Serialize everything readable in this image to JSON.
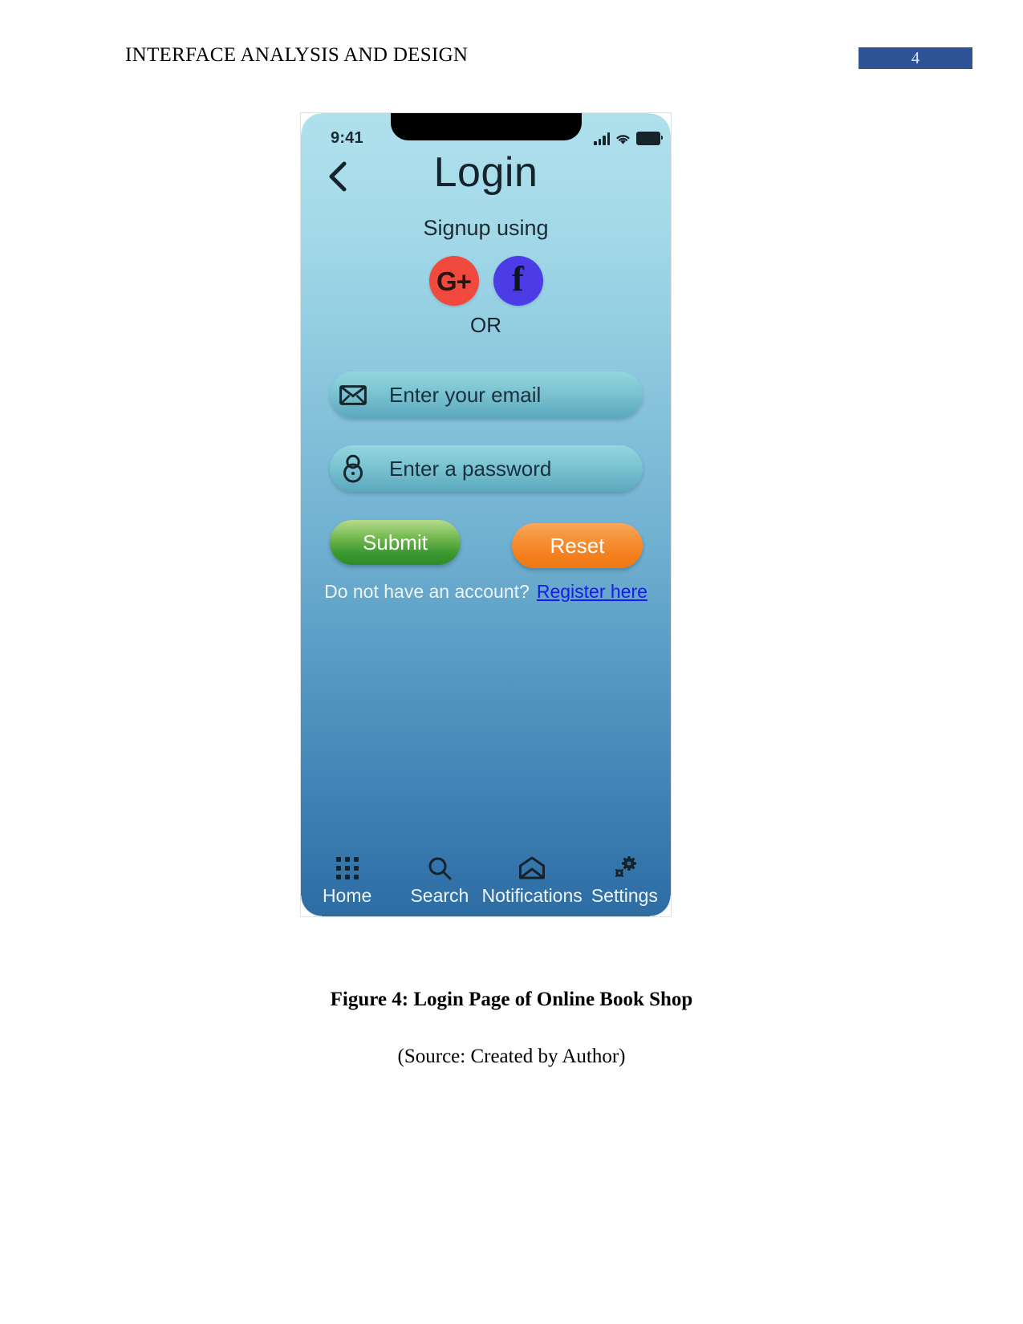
{
  "document": {
    "header_title": "INTERFACE ANALYSIS AND DESIGN",
    "page_number": "4",
    "figure_caption": "Figure 4: Login Page of Online Book Shop",
    "source_caption": "(Source:  Created by Author)",
    "page_number_color": "#2F5496"
  },
  "phone": {
    "status_bar": {
      "time": "9:41",
      "signal_icon": "signal-bars-icon",
      "wifi_icon": "wifi-icon",
      "battery_icon": "battery-icon"
    },
    "app_header": {
      "back_icon": "back-chevron-icon",
      "title": "Login"
    },
    "signup": {
      "label": "Signup using",
      "providers": [
        {
          "name": "google-plus",
          "glyph": "G+",
          "color": "#F2493E"
        },
        {
          "name": "facebook",
          "glyph": "f",
          "color": "#4B3CE8"
        }
      ],
      "divider": "OR"
    },
    "form": {
      "email": {
        "icon": "envelope-icon",
        "placeholder": "Enter your email",
        "value": ""
      },
      "password": {
        "icon": "lock-icon",
        "placeholder": "Enter a password",
        "value": ""
      },
      "submit_label": "Submit",
      "reset_label": "Reset",
      "submit_color": "#3E9A32",
      "reset_color": "#F4801F"
    },
    "register": {
      "prompt": "Do not have an account?",
      "link_label": "Register here",
      "link_color": "#1A1AEE"
    },
    "bottom_nav": [
      {
        "label": "Home",
        "icon": "grid-dots-icon"
      },
      {
        "label": "Search",
        "icon": "search-icon"
      },
      {
        "label": "Notifications",
        "icon": "envelope-open-icon"
      },
      {
        "label": "Settings",
        "icon": "gear-icon"
      }
    ],
    "background_gradient": {
      "top": "#AEE1EC",
      "bottom": "#2E6CA4"
    }
  }
}
